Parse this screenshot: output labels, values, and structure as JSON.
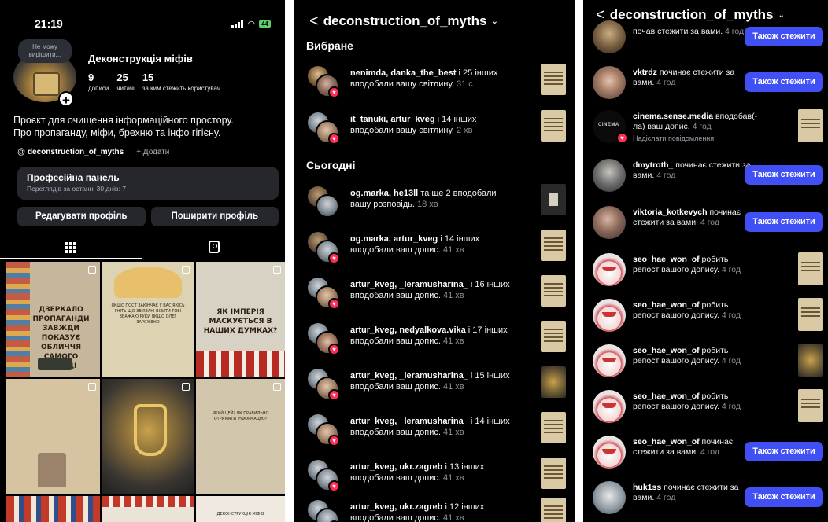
{
  "profile": {
    "time": "21:19",
    "battery": "44",
    "note": "Не можу вирішити...",
    "name": "Деконструкція міфів",
    "stats": [
      {
        "value": "9",
        "label": "дописи"
      },
      {
        "value": "25",
        "label": "читачі"
      },
      {
        "value": "15",
        "label": "за ким стежить користувач"
      }
    ],
    "bio_line1": "Проєкт для очищення інформаційного простору.",
    "bio_line2": "Про пропаганду, міфи, брехню та інфо гігієну.",
    "handle": "deconstruction_of_myths",
    "add_label": "+ Додати",
    "pro_title": "Професійна панель",
    "pro_sub": "Переглядів за останні 30 днів: 7",
    "edit_button": "Редагувати профіль",
    "share_button": "Поширити профіль",
    "posts": [
      {
        "text": "ДЗЕРКАЛО ПРОПАГАНДИ ЗАВЖДИ ПОКАЗУЄ ОБЛИЧЧЯ САМОГО ВБИВЦІ"
      },
      {
        "text": "ЯКЩО ПОСТ ЗАКІНЧАЄ У ВАС ЯКІСЬ ГНІТЬ ЩО ЗВ'ЯЗАНІ ВІЗИТИ ТОБІ ВВАЖАЮ РУКИ ЯКЩО ОЛЕГ ЗАРЯЖЕНО"
      },
      {
        "text": "ЯК ІМПЕРІЯ МАСКУЄТЬСЯ В НАШИХ ДУМКАХ?"
      },
      {
        "text": ""
      },
      {
        "text": ""
      },
      {
        "text": "ЯКИЙ ЦЕЙ? ЯК ПРАВИЛЬНО ОТРИМАТИ ІНФОРМАЦІЮ?"
      },
      {
        "text": ""
      },
      {
        "text": ""
      },
      {
        "text": "ДЕКОНСТРУКЦІЯ МІФІВ"
      }
    ]
  },
  "activity": {
    "header": "deconstruction_of_myths",
    "favorites_title": "Вибране",
    "today_title": "Сьогодні",
    "favorites": [
      {
        "names": "nenimda, danka_the_best",
        "rest": " і 25 інших вподобали вашу світлину.",
        "time": "31 с"
      },
      {
        "names": "it_tanuki, artur_kveg",
        "rest": " і 14 інших вподобали вашу світлину.",
        "time": "2 хв"
      }
    ],
    "today": [
      {
        "names": "og.marka, he13ll",
        "rest": " та ще 2 вподобали вашу розповідь.",
        "time": "18 хв"
      },
      {
        "names": "og.marka, artur_kveg",
        "rest": " і 14 інших вподобали ваш допис.",
        "time": "41 хв"
      },
      {
        "names": "artur_kveg, _leramusharina_",
        "rest": " і 16 інших вподобали ваш допис.",
        "time": "41 хв"
      },
      {
        "names": "artur_kveg, nedyalkova.vika",
        "rest": " і 17 інших вподобали ваш допис.",
        "time": "41 хв"
      },
      {
        "names": "artur_kveg, _leramusharina_",
        "rest": " і 15 інших вподобали ваш допис.",
        "time": "41 хв"
      },
      {
        "names": "artur_kveg, _leramusharina_",
        "rest": " і 14 інших вподобали ваш допис.",
        "time": "41 хв"
      },
      {
        "names": "artur_kveg, ukr.zagreb",
        "rest": " і 13 інших вподобали ваш допис.",
        "time": "41 хв"
      },
      {
        "names": "artur_kveg, ukr.zagreb",
        "rest": " і 12 інших вподобали ваш допис.",
        "time": "41 хв"
      }
    ]
  },
  "activity2": {
    "header": "deconstruction_of_myths",
    "follow_label": "Також стежити",
    "items": [
      {
        "user": "",
        "text": "почав стежити за вами.",
        "time": "4 год",
        "kind": "follow"
      },
      {
        "user": "vktrdz",
        "text": " починає стежити за вами.",
        "time": "4 год",
        "kind": "follow"
      },
      {
        "user": "cinema.sense.media",
        "text": " вподобав(-ла) ваш допис.",
        "time": "4 год",
        "kind": "like",
        "extra": "Надіслати повідомлення"
      },
      {
        "user": "dmytroth_",
        "text": " починає стежити за вами.",
        "time": "4 год",
        "kind": "follow"
      },
      {
        "user": "viktoria_kotkevych",
        "text": " починає стежити за вами.",
        "time": "4 год",
        "kind": "follow"
      },
      {
        "user": "seo_hae_won_of",
        "text": " робить репост вашого допису.",
        "time": "4 год",
        "kind": "repost"
      },
      {
        "user": "seo_hae_won_of",
        "text": " робить репост вашого допису.",
        "time": "4 год",
        "kind": "repost"
      },
      {
        "user": "seo_hae_won_of",
        "text": " робить репост вашого допису.",
        "time": "4 год",
        "kind": "repost"
      },
      {
        "user": "seo_hae_won_of",
        "text": " робить репост вашого допису.",
        "time": "4 год",
        "kind": "repost"
      },
      {
        "user": "seo_hae_won_of",
        "text": " починає стежити за вами.",
        "time": "4 год",
        "kind": "follow"
      },
      {
        "user": "huk1ss",
        "text": " починає стежити за вами.",
        "time": "4 год",
        "kind": "follow"
      }
    ]
  },
  "colors": {
    "background": "#000000",
    "button_blue": "#4150f5",
    "heart_red": "#ff2c55",
    "panel_gray": "#25272c"
  }
}
